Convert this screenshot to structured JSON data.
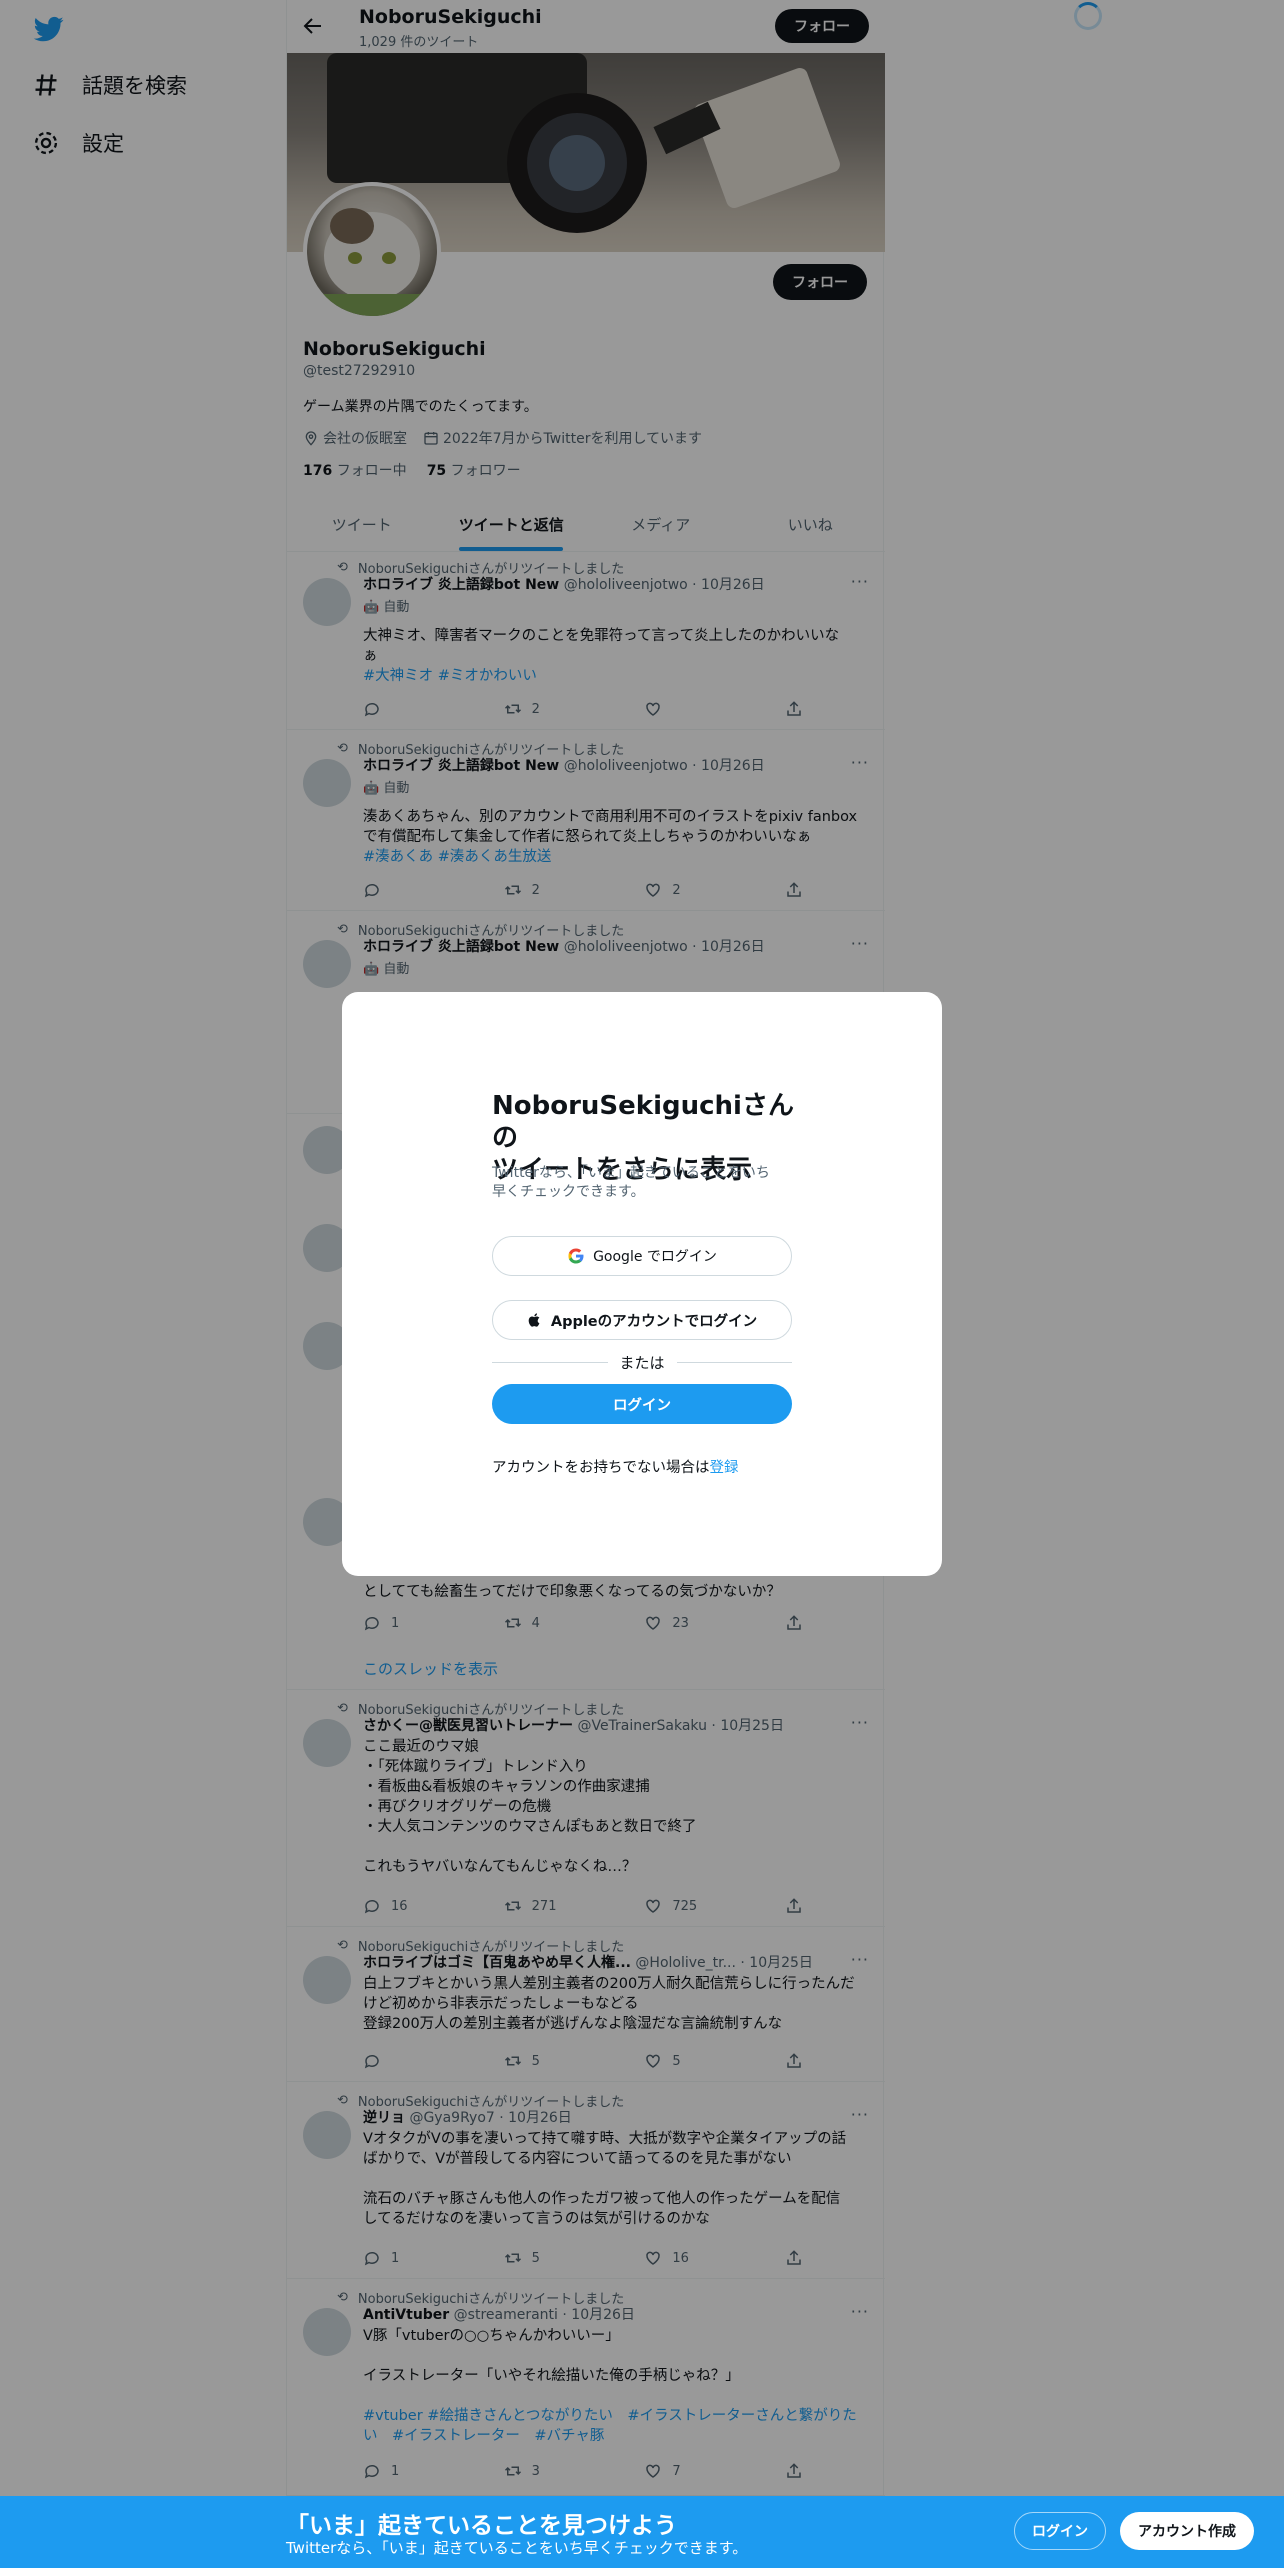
{
  "sidebar": {
    "explore": "話題を検索",
    "settings": "設定"
  },
  "header": {
    "name": "NoboruSekiguchi",
    "tweet_count": "1,029 件のツイート",
    "follow": "フォロー"
  },
  "profile": {
    "name": "NoboruSekiguchi",
    "handle": "@test27292910",
    "bio": "ゲーム業界の片隅でのたくってます。",
    "location": "会社の仮眠室",
    "joined": "2022年7月からTwitterを利用しています",
    "following_count": "176",
    "following_label": "フォロー中",
    "followers_count": "75",
    "followers_label": "フォロワー",
    "follow": "フォロー"
  },
  "tabs": [
    "ツイート",
    "ツイートと返信",
    "メディア",
    "いいね"
  ],
  "tweets": [
    {
      "rt": "NoboruSekiguchiさんがリツイートしました",
      "name": "ホロライブ 炎上語録bot New",
      "meta": "@hololiveenjotwo · 10月26日",
      "auto": "自動",
      "text": "大神ミオ、障害者マークのことを免罪符って言って炎上したのかわいいな\nぁ",
      "tags": "#大神ミオ #ミオかわいい",
      "reply": "",
      "retweet": "2",
      "like": ""
    },
    {
      "rt": "NoboruSekiguchiさんがリツイートしました",
      "name": "ホロライブ 炎上語録bot New",
      "meta": "@hololiveenjotwo · 10月26日",
      "auto": "自動",
      "text": "湊あくあちゃん、別のアカウントで商用利用不可のイラストをpixiv fanbox\nで有償配布して集金して作者に怒られて炎上しちゃうのかわいいなぁ",
      "tags": "#湊あくあ #湊あくあ生放送",
      "reply": "",
      "retweet": "2",
      "like": "2"
    },
    {
      "rt": "NoboruSekiguchiさんがリツイートしました",
      "name": "ホロライブ 炎上語録bot New",
      "meta": "@hololiveenjotwo · 10月26日",
      "auto": "自動"
    },
    {
      "text": "としてても絵畜生ってだけで印象悪くなってるの気づかないか？",
      "reply": "1",
      "retweet": "4",
      "like": "23",
      "thread": "このスレッドを表示"
    },
    {
      "rt": "NoboruSekiguchiさんがリツイートしました",
      "name": "さかくー@獣医見習いトレーナー",
      "meta": "@VeTrainerSakaku · 10月25日",
      "text": "ここ最近のウマ娘\n・「死体蹴りライブ」トレンド入り\n・看板曲&看板娘のキャラソンの作曲家逮捕\n・再びクリオグリゲーの危機\n・大人気コンテンツのウマさんぽもあと数日で終了\n\nこれもうヤバいなんてもんじゃなくね…？",
      "reply": "16",
      "retweet": "271",
      "like": "725"
    },
    {
      "rt": "NoboruSekiguchiさんがリツイートしました",
      "name": "ホロライブはゴミ【百鬼あやめ早く人権...",
      "meta": "@Hololive_tr... · 10月25日",
      "text": "白上フブキとかいう黒人差別主義者の200万人耐久配信荒らしに行ったんだ\nけど初めから非表示だったしょーもなどる\n登録200万人の差別主義者が逃げんなよ陰湿だな言論統制すんな",
      "reply": "",
      "retweet": "5",
      "like": "5"
    },
    {
      "rt": "NoboruSekiguchiさんがリツイートしました",
      "name": "逆リョ",
      "meta": "@Gya9Ryo7 · 10月26日",
      "text": "VオタクがVの事を凄いって持て囃す時、大抵が数字や企業タイアップの話\nばかりで、Vが普段してる内容について語ってるのを見た事がない\n\n流石のバチャ豚さんも他人の作ったガワ被って他人の作ったゲームを配信\nしてるだけなのを凄いって言うのは気が引けるのかな",
      "reply": "1",
      "retweet": "5",
      "like": "16"
    },
    {
      "rt": "NoboruSekiguchiさんがリツイートしました",
      "name": "AntiVtuber",
      "meta": "@streameranti · 10月26日",
      "text": "V豚「vtuberの○○ちゃんかわいいー」\n\nイラストレーター「いやそれ絵描いた俺の手柄じゃね？」",
      "tags": "#vtuber #絵描きさんとつながりたい　#イラストレーターさんと繋がりた\nい　#イラストレーター　#バチャ豚",
      "reply": "1",
      "retweet": "3",
      "like": "7"
    }
  ],
  "modal": {
    "title": "NoboruSekiguchiさんの\nツイートをさらに表示",
    "subtitle": "Twitterなら、「いま」起きていることをいち\n早くチェックできます。",
    "google": "Google でログイン",
    "apple": "Appleのアカウントでログイン",
    "or": "または",
    "login": "ログイン",
    "signup_prompt": "アカウントをお持ちでない場合は",
    "signup_link": "登録"
  },
  "bottom": {
    "title": "「いま」起きていることを見つけよう",
    "subtitle": "Twitterなら、「いま」起きていることをいち早くチェックできます。",
    "login": "ログイン",
    "signup": "アカウント作成"
  },
  "colors": {
    "accent": "#1d9bf0",
    "text": "#0f1419",
    "muted": "#536471"
  }
}
